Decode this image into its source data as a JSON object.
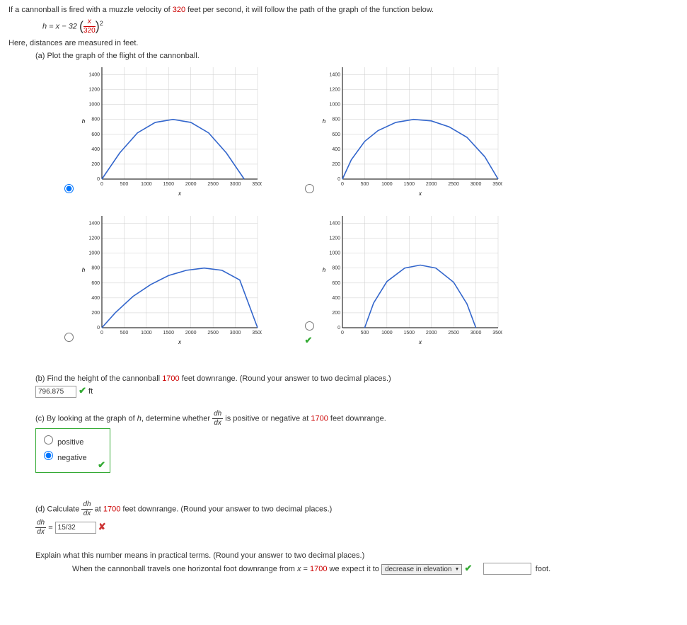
{
  "intro_p1": "If a cannonball is fired with a muzzle velocity of ",
  "intro_vel": "320",
  "intro_p2": " feet per second, it will follow the path of the graph of the function below.",
  "eq_lhs": "h = x − 32",
  "eq_frac_num": "x",
  "eq_frac_den": "320",
  "eq_exp": "2",
  "here_line": "Here, distances are measured in feet.",
  "part_a_text": "(a) Plot the graph of the flight of the cannonball.",
  "part_b_p1": "(b) Find the height of the cannonball ",
  "part_b_val": "1700",
  "part_b_p2": " feet downrange. (Round your answer to two decimal places.)",
  "part_b_answer": "796.875",
  "part_b_unit": "ft",
  "part_c_p1": "(c) By looking at the graph of ",
  "part_c_hvar": "h",
  "part_c_p2": ", determine whether ",
  "part_c_dnum": "dh",
  "part_c_dden": "dx",
  "part_c_p3": " is positive or negative at ",
  "part_c_val": "1700",
  "part_c_p4": " feet downrange.",
  "opt_pos": "positive",
  "opt_neg": "negative",
  "part_d_p1": "(d) Calculate ",
  "part_d_dnum": "dh",
  "part_d_dden": "dx",
  "part_d_p2": " at ",
  "part_d_val": "1700",
  "part_d_p3": " feet downrange. (Round your answer to two decimal places.)",
  "part_d_lhs_num": "dh",
  "part_d_lhs_den": "dx",
  "part_d_eqls": " = ",
  "part_d_answer": "15/32",
  "explain_p1": "Explain what this number means in practical terms. (Round your answer to two decimal places.)",
  "explain_s1": "When the cannonball travels one horizontal foot downrange from ",
  "explain_xvar": "x",
  "explain_s2": " = ",
  "explain_val": "1700",
  "explain_s3": " we expect it to ",
  "explain_select": "decrease in elevation",
  "explain_unit": "foot.",
  "chart_data": [
    {
      "type": "line",
      "title": "",
      "xlabel": "x",
      "ylabel": "h",
      "xlim": [
        0,
        3500
      ],
      "ylim": [
        0,
        1500
      ],
      "x_ticks": [
        0,
        500,
        1000,
        1500,
        2000,
        2500,
        3000,
        3500
      ],
      "y_ticks": [
        0,
        200,
        400,
        600,
        800,
        1000,
        1200,
        1400
      ],
      "series": [
        {
          "name": "trajectory",
          "x": [
            0,
            400,
            800,
            1200,
            1600,
            2000,
            2400,
            2800,
            3200
          ],
          "values": [
            0,
            350,
            620,
            760,
            800,
            760,
            620,
            350,
            0
          ]
        }
      ]
    },
    {
      "type": "line",
      "title": "",
      "xlabel": "x",
      "ylabel": "h",
      "xlim": [
        0,
        3500
      ],
      "ylim": [
        0,
        1500
      ],
      "x_ticks": [
        0,
        500,
        1000,
        1500,
        2000,
        2500,
        3000,
        3500
      ],
      "y_ticks": [
        0,
        200,
        400,
        600,
        800,
        1000,
        1200,
        1400
      ],
      "series": [
        {
          "name": "trajectory",
          "x": [
            0,
            200,
            500,
            800,
            1200,
            1600,
            2000,
            2400,
            2800,
            3200,
            3500
          ],
          "values": [
            0,
            260,
            505,
            650,
            760,
            800,
            780,
            700,
            560,
            300,
            0
          ]
        }
      ]
    },
    {
      "type": "line",
      "title": "",
      "xlabel": "x",
      "ylabel": "h",
      "xlim": [
        0,
        3500
      ],
      "ylim": [
        0,
        1500
      ],
      "x_ticks": [
        0,
        500,
        1000,
        1500,
        2000,
        2500,
        3000,
        3500
      ],
      "y_ticks": [
        0,
        200,
        400,
        600,
        800,
        1000,
        1200,
        1400
      ],
      "series": [
        {
          "name": "trajectory",
          "x": [
            0,
            300,
            700,
            1100,
            1500,
            1900,
            2300,
            2700,
            3100,
            3500
          ],
          "values": [
            0,
            200,
            420,
            580,
            700,
            770,
            800,
            770,
            640,
            0
          ]
        }
      ]
    },
    {
      "type": "line",
      "title": "",
      "xlabel": "x",
      "ylabel": "h",
      "xlim": [
        0,
        3500
      ],
      "ylim": [
        0,
        1500
      ],
      "x_ticks": [
        0,
        500,
        1000,
        1500,
        2000,
        2500,
        3000,
        3500
      ],
      "y_ticks": [
        0,
        200,
        400,
        600,
        800,
        1000,
        1200,
        1400
      ],
      "series": [
        {
          "name": "trajectory",
          "x": [
            500,
            700,
            1000,
            1400,
            1750,
            2100,
            2500,
            2800,
            3000
          ],
          "values": [
            0,
            330,
            620,
            800,
            840,
            800,
            610,
            320,
            0
          ]
        }
      ]
    }
  ]
}
